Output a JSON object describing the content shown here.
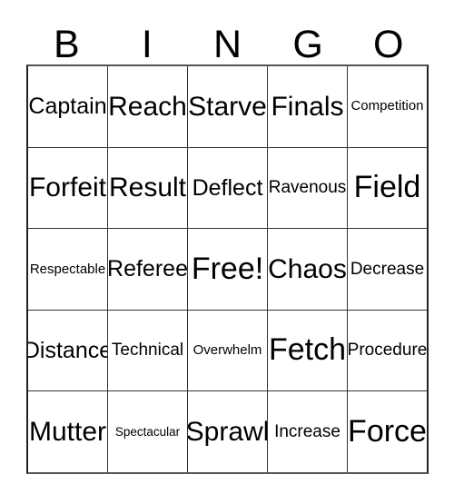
{
  "card": {
    "title": "BINGO",
    "header_letters": [
      "B",
      "I",
      "N",
      "G",
      "O"
    ],
    "columns": 5,
    "rows": 5,
    "free_space": "Free!",
    "free_space_position": {
      "row": 3,
      "column": 3
    },
    "colors": {
      "background": "#ffffff",
      "text": "#000000",
      "border": "#333333",
      "outer_border": "#555555"
    },
    "cells": [
      [
        {
          "text": "Captain",
          "size": "md"
        },
        {
          "text": "Reach",
          "size": "lg"
        },
        {
          "text": "Starve",
          "size": "lg"
        },
        {
          "text": "Finals",
          "size": "lg"
        },
        {
          "text": "Competition",
          "size": "xs"
        }
      ],
      [
        {
          "text": "Forfeit",
          "size": "lg"
        },
        {
          "text": "Result",
          "size": "lg"
        },
        {
          "text": "Deflect",
          "size": "md"
        },
        {
          "text": "Ravenous",
          "size": "sm"
        },
        {
          "text": "Field",
          "size": "xl"
        }
      ],
      [
        {
          "text": "Respectable",
          "size": "xs"
        },
        {
          "text": "Referee",
          "size": "md"
        },
        {
          "text": "Free!",
          "size": "xl"
        },
        {
          "text": "Chaos",
          "size": "lg"
        },
        {
          "text": "Decrease",
          "size": "sm"
        }
      ],
      [
        {
          "text": "Distance",
          "size": "md"
        },
        {
          "text": "Technical",
          "size": "sm"
        },
        {
          "text": "Overwhelm",
          "size": "xs"
        },
        {
          "text": "Fetch",
          "size": "xl"
        },
        {
          "text": "Procedure",
          "size": "sm"
        }
      ],
      [
        {
          "text": "Mutter",
          "size": "lg"
        },
        {
          "text": "Spectacular",
          "size": "xxs"
        },
        {
          "text": "Sprawl",
          "size": "lg"
        },
        {
          "text": "Increase",
          "size": "sm"
        },
        {
          "text": "Force",
          "size": "xl"
        }
      ]
    ]
  }
}
